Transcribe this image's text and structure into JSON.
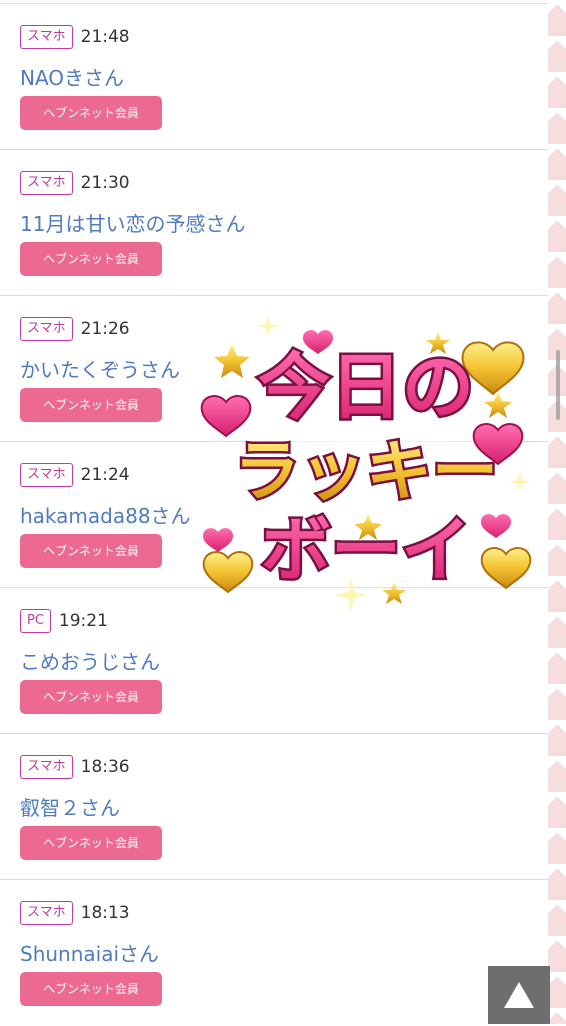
{
  "entries": [
    {
      "device": "スマホ",
      "time": "21:48",
      "name": "NAOきさん",
      "member_label": "ヘブンネット会員"
    },
    {
      "device": "スマホ",
      "time": "21:30",
      "name": "11月は甘い恋の予感さん",
      "member_label": "ヘブンネット会員"
    },
    {
      "device": "スマホ",
      "time": "21:26",
      "name": "かいたくぞうさん",
      "member_label": "ヘブンネット会員"
    },
    {
      "device": "スマホ",
      "time": "21:24",
      "name": "hakamada88さん",
      "member_label": "ヘブンネット会員"
    },
    {
      "device": "PC",
      "time": "19:21",
      "name": "こめおうじさん",
      "member_label": "ヘブンネット会員"
    },
    {
      "device": "スマホ",
      "time": "18:36",
      "name": "叡智２さん",
      "member_label": "ヘブンネット会員"
    },
    {
      "device": "スマホ",
      "time": "18:13",
      "name": "Shunnaiaiさん",
      "member_label": "ヘブンネット会員"
    }
  ],
  "overlay": {
    "lines": [
      "今日の",
      "ラッキー",
      "ボーイ"
    ],
    "colors": {
      "pink": "#e8307f",
      "gold": "#f2c230",
      "outline": "#7a1040"
    }
  },
  "scroll_top_icon": "triangle-up-icon",
  "colors": {
    "name_link": "#4f7bbf",
    "device_badge": "#c23a9d",
    "member_button": "#ec6a92",
    "scroll_button": "#6e6e6e"
  }
}
